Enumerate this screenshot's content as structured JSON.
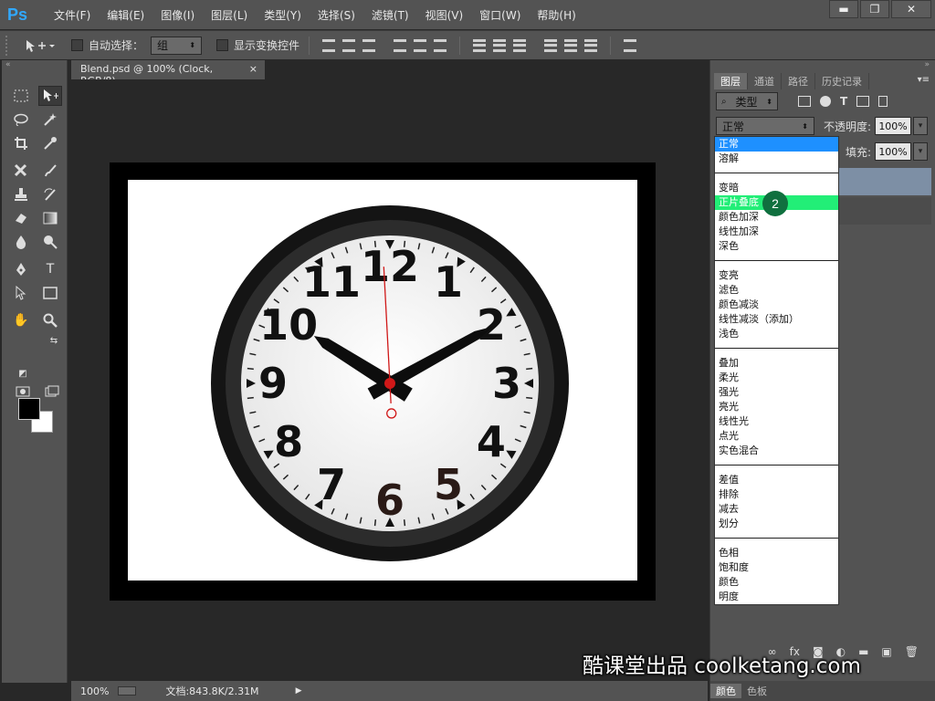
{
  "app": {
    "logo": "Ps"
  },
  "menu": [
    "文件(F)",
    "编辑(E)",
    "图像(I)",
    "图层(L)",
    "类型(Y)",
    "选择(S)",
    "滤镜(T)",
    "视图(V)",
    "窗口(W)",
    "帮助(H)"
  ],
  "window_controls": {
    "minimize": "▬",
    "maximize": "❐",
    "close": "✕"
  },
  "options": {
    "auto_select_label": "自动选择：",
    "auto_select_value": "组",
    "show_transform_label": "显示变换控件"
  },
  "document": {
    "tab_title": "Blend.psd @ 100% (Clock, RGB/8)",
    "tab_close": "×",
    "zoom": "100%",
    "doc_info": "文档:843.8K/2.31M"
  },
  "clock": {
    "numerals": [
      "12",
      "1",
      "2",
      "3",
      "4",
      "5",
      "6",
      "7",
      "8",
      "9",
      "10",
      "11"
    ],
    "hour_angle_deg": 302,
    "minute_angle_deg": 61,
    "second_angle_deg": 357
  },
  "panels": {
    "tabs": [
      "图层",
      "通道",
      "路径",
      "历史记录"
    ],
    "active_tab": "图层",
    "filter_label": "类型",
    "blend_mode": "正常",
    "opacity_label": "不透明度:",
    "opacity_value": "100%",
    "fill_label": "填充:",
    "fill_value": "100%",
    "color_tabs": [
      "颜色",
      "色板"
    ]
  },
  "blend_dropdown": {
    "groups": [
      [
        "正常",
        "溶解"
      ],
      [
        "变暗",
        "正片叠底",
        "颜色加深",
        "线性加深",
        "深色"
      ],
      [
        "变亮",
        "滤色",
        "颜色减淡",
        "线性减淡（添加）",
        "浅色"
      ],
      [
        "叠加",
        "柔光",
        "强光",
        "亮光",
        "线性光",
        "点光",
        "实色混合"
      ],
      [
        "差值",
        "排除",
        "减去",
        "划分"
      ],
      [
        "色相",
        "饱和度",
        "颜色",
        "明度"
      ]
    ],
    "selected": "正常",
    "highlighted": "正片叠底",
    "step_badge": "2"
  },
  "watermark": "酷课堂出品 coolketang.com",
  "colors": {
    "highlight": "#22ee77",
    "selected": "#1e90ff",
    "badge": "#10703f",
    "panel_bg": "#535353"
  }
}
